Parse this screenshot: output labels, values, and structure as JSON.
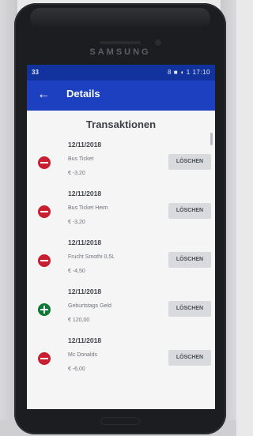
{
  "device": {
    "brand": "SAMSUNG"
  },
  "status_bar": {
    "left": "33",
    "right": "8 ■ ◖ 1 17:10"
  },
  "app_bar": {
    "back_icon": "arrow-left-icon",
    "title": "Details"
  },
  "page": {
    "title": "Transaktionen"
  },
  "transactions": [
    {
      "date": "12/11/2018",
      "name": "Bus Ticket",
      "amount": "€ -3,20",
      "type": "expense",
      "icon": "minus-circle-icon",
      "action": "LÖSCHEN"
    },
    {
      "date": "12/11/2018",
      "name": "Bus Ticket Heim",
      "amount": "€ -3,20",
      "type": "expense",
      "icon": "minus-circle-icon",
      "action": "LÖSCHEN"
    },
    {
      "date": "12/11/2018",
      "name": "Frucht Smothi 0,5L",
      "amount": "€ -4,50",
      "type": "expense",
      "icon": "minus-circle-icon",
      "action": "LÖSCHEN"
    },
    {
      "date": "12/11/2018",
      "name": "Geburtstags Geld",
      "amount": "€ 120,00",
      "type": "income",
      "icon": "plus-circle-icon",
      "action": "LÖSCHEN"
    },
    {
      "date": "12/11/2018",
      "name": "Mc Donalds",
      "amount": "€ -6,00",
      "type": "expense",
      "icon": "minus-circle-icon",
      "action": "LÖSCHEN"
    }
  ],
  "colors": {
    "status_bar": "#12339e",
    "app_bar": "#1d40c1",
    "expense_icon": "#c71f2f",
    "income_icon": "#0c7a31"
  }
}
